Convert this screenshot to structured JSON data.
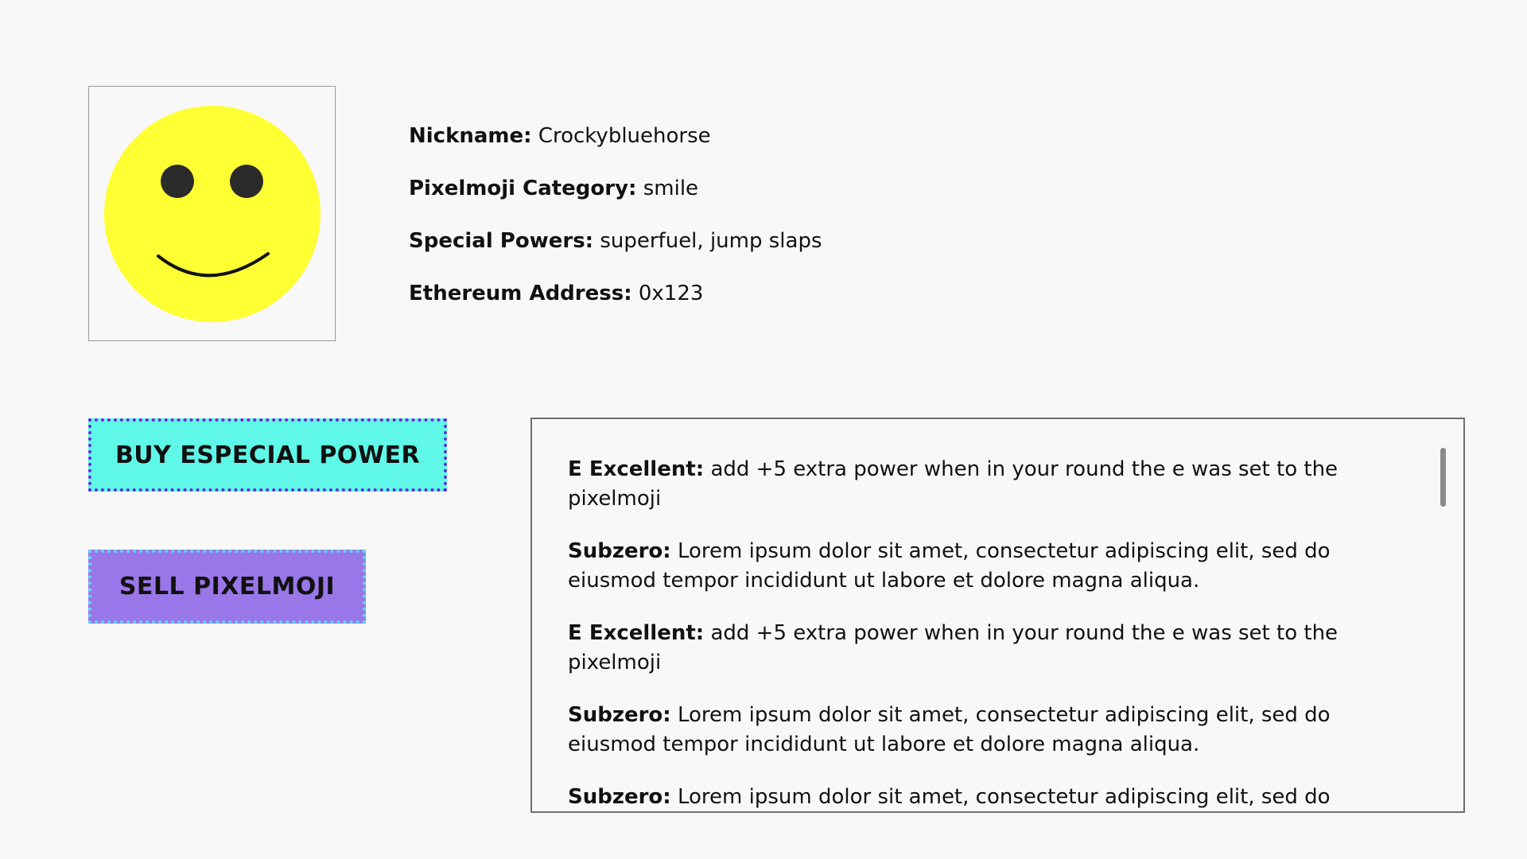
{
  "avatar": {
    "icon": "smiley-face-icon",
    "face_color": "#ffff33",
    "feature_color": "#2b2b2b"
  },
  "profile": {
    "nickname_label": "Nickname:",
    "nickname_value": "Crockybluehorse",
    "category_label": "Pixelmoji Category:",
    "category_value": "smile",
    "powers_label": "Special Powers:",
    "powers_value": "superfuel, jump slaps",
    "address_label": "Ethereum Address:",
    "address_value": "0x123"
  },
  "actions": {
    "buy_label": "BUY ESPECIAL POWER",
    "sell_label": "SELL PIXELMOJI",
    "buy_color": "#5ff8e8",
    "sell_color": "#9a77e8"
  },
  "powers": [
    {
      "name": "E Excellent:",
      "desc": "add +5 extra power when in your round the e was set to the pixelmoji"
    },
    {
      "name": "Subzero:",
      "desc": "Lorem ipsum dolor sit amet, consectetur adipiscing elit, sed do eiusmod tempor incididunt ut labore et dolore magna aliqua."
    },
    {
      "name": "E Excellent:",
      "desc": "add +5 extra power when in your round the e was set to the pixelmoji"
    },
    {
      "name": "Subzero:",
      "desc": "Lorem ipsum dolor sit amet, consectetur adipiscing elit, sed do eiusmod tempor incididunt ut labore et dolore magna aliqua."
    },
    {
      "name": "Subzero:",
      "desc": "Lorem ipsum dolor sit amet, consectetur adipiscing elit, sed do eiusmod tempor incididunt ut labore et dolore magna aliqua."
    }
  ]
}
